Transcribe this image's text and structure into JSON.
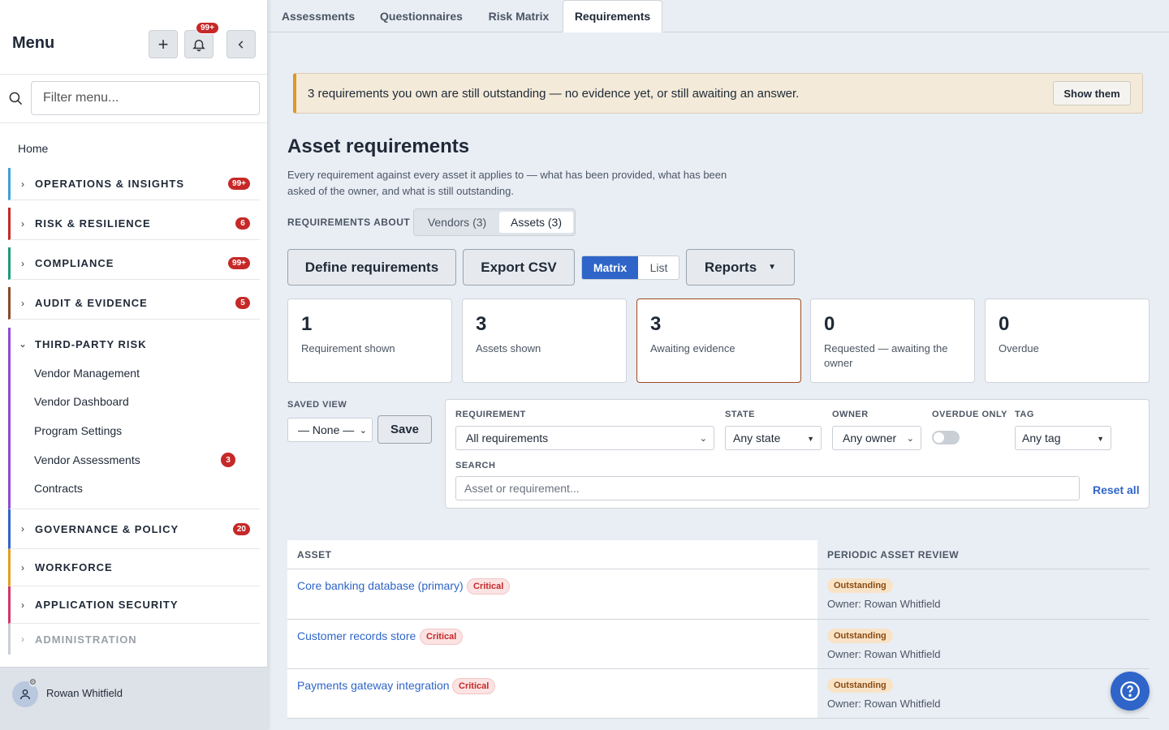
{
  "sidebar": {
    "title": "Menu",
    "notif_badge": "99+",
    "search_placeholder": "Filter menu...",
    "home": "Home",
    "sections": [
      {
        "label": "OPERATIONS & INSIGHTS",
        "badge": "99+",
        "color": "#3fa0d8"
      },
      {
        "label": "RISK & RESILIENCE",
        "badge": "6",
        "color": "#c62828"
      },
      {
        "label": "COMPLIANCE",
        "badge": "99+",
        "color": "#1d9a7a"
      },
      {
        "label": "AUDIT & EVIDENCE",
        "badge": "5",
        "color": "#8b4a2b"
      },
      {
        "label": "THIRD-PARTY RISK",
        "badge": "",
        "color": "#8e4bd1"
      },
      {
        "label": "GOVERNANCE & POLICY",
        "badge": "20",
        "color": "#2f65c9"
      },
      {
        "label": "WORKFORCE",
        "badge": "",
        "color": "#e0a020"
      },
      {
        "label": "APPLICATION SECURITY",
        "badge": "",
        "color": "#d0386a"
      },
      {
        "label": "ADMINISTRATION",
        "badge": "",
        "color": "#9aa1a9"
      }
    ],
    "third_party_items": [
      {
        "label": "Vendor Management"
      },
      {
        "label": "Vendor Dashboard"
      },
      {
        "label": "Program Settings"
      },
      {
        "label": "Vendor Assessments",
        "badge": "3"
      },
      {
        "label": "Contracts"
      }
    ],
    "user_name": "Rowan Whitfield"
  },
  "tabs": [
    "Assessments",
    "Questionnaires",
    "Risk Matrix",
    "Requirements"
  ],
  "alert": {
    "text": "3 requirements you own are still outstanding — no evidence yet, or still awaiting an answer.",
    "button": "Show them"
  },
  "page": {
    "title": "Asset requirements",
    "description": "Every requirement against every asset it applies to — what has been provided, what has been asked of the owner, and what is still outstanding.",
    "requirements_about_label": "REQUIREMENTS ABOUT",
    "segments": [
      "Vendors (3)",
      "Assets (3)"
    ]
  },
  "toolbar": {
    "define": "Define requirements",
    "export": "Export CSV",
    "matrix": "Matrix",
    "list": "List",
    "reports": "Reports"
  },
  "stats": [
    {
      "num": "1",
      "label": "Requirement shown"
    },
    {
      "num": "3",
      "label": "Assets shown"
    },
    {
      "num": "3",
      "label": "Awaiting evidence"
    },
    {
      "num": "0",
      "label": "Requested — awaiting the owner"
    },
    {
      "num": "0",
      "label": "Overdue"
    }
  ],
  "saved_view": {
    "label": "SAVED VIEW",
    "value": "— None —",
    "save": "Save"
  },
  "filters": {
    "requirement_label": "REQUIREMENT",
    "requirement_value": "All requirements",
    "state_label": "STATE",
    "state_value": "Any state",
    "owner_label": "OWNER",
    "owner_value": "Any owner",
    "overdue_label": "OVERDUE ONLY",
    "tag_label": "TAG",
    "tag_value": "Any tag",
    "search_label": "SEARCH",
    "search_placeholder": "Asset or requirement...",
    "reset": "Reset all"
  },
  "table": {
    "headers": [
      "ASSET",
      "PERIODIC ASSET REVIEW"
    ],
    "rows": [
      {
        "asset": "Core banking database (primary)",
        "tag": "Critical",
        "status": "Outstanding",
        "owner": "Owner: Rowan Whitfield"
      },
      {
        "asset": "Customer records store",
        "tag": "Critical",
        "status": "Outstanding",
        "owner": "Owner: Rowan Whitfield"
      },
      {
        "asset": "Payments gateway integration",
        "tag": "Critical",
        "status": "Outstanding",
        "owner": "Owner: Rowan Whitfield"
      }
    ]
  }
}
